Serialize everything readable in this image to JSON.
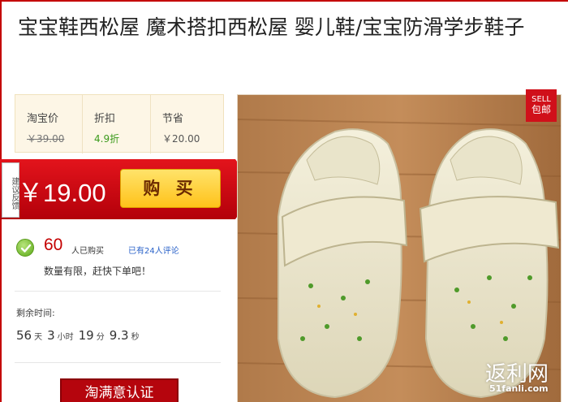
{
  "product": {
    "title": "宝宝鞋西松屋 魔术搭扣西松屋 婴儿鞋/宝宝防滑学步鞋子"
  },
  "price_info": {
    "taobao_label": "淘宝价",
    "taobao_value": "￥39.00",
    "discount_label": "折扣",
    "discount_value": "4.9折",
    "save_label": "节省",
    "save_value": "￥20.00"
  },
  "deal": {
    "price": "￥19.00",
    "buy_label": "购 买",
    "feedback_label": "建议反馈"
  },
  "sales": {
    "count": "60",
    "bought_text": "人已购买",
    "review_text": "已有24人评论",
    "limited_text": "数量有限，赶快下单吧！"
  },
  "countdown": {
    "label": "剩余时间:",
    "days": "56",
    "days_unit": "天",
    "hours": "3",
    "hours_unit": "小时",
    "minutes": "19",
    "minutes_unit": "分",
    "seconds": "9.3",
    "seconds_unit": "秒"
  },
  "badge": {
    "line1": "SELL",
    "line2": "包邮"
  },
  "tmall_button": "淘满意认证",
  "watermark": {
    "text": "返利网",
    "site": "51fanli.com"
  },
  "colors": {
    "brand_red": "#c40000",
    "buy_button": "#ffc21a",
    "discount_green": "#3c9a1c",
    "link_blue": "#2a62c9"
  }
}
